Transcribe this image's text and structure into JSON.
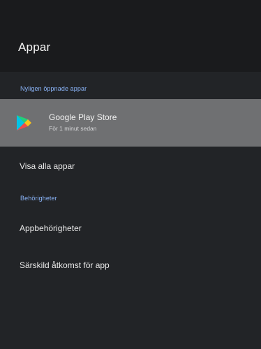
{
  "screen": {
    "title": "Appar"
  },
  "recent_section": {
    "label": "Nyligen öppnade appar"
  },
  "focused_app": {
    "name": "Google Play Store",
    "subtitle": "För 1 minut sedan",
    "icon": "google-play-icon"
  },
  "menu": {
    "view_all": "Visa alla appar",
    "permissions_section": "Behörigheter",
    "app_permissions": "Appbehörigheter",
    "special_access": "Särskild åtkomst för app"
  },
  "colors": {
    "accent": "#8ab4f8",
    "focus_bg": "#6f7072",
    "panel_bg": "#222427"
  }
}
